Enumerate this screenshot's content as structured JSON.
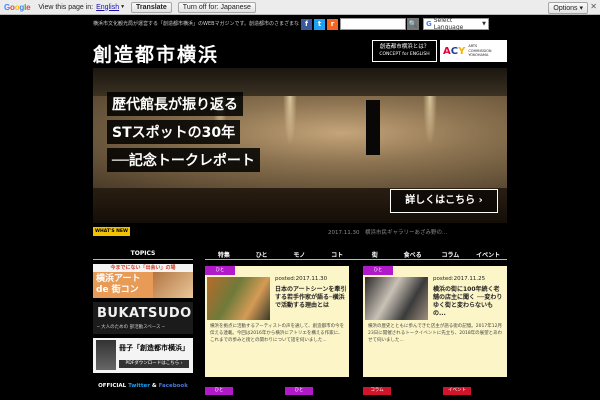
{
  "translate_bar": {
    "logo": [
      "G",
      "o",
      "o",
      "g",
      "l",
      "e"
    ],
    "view_text": "View this page in:",
    "language": "English",
    "translate_btn": "Translate",
    "turn_off_btn": "Turn off for: Japanese",
    "options": "Options ▾",
    "close": "✕"
  },
  "header": {
    "tagline": "横浜市文化観光局が運営する「創造都市横浜」のWEBマガジンです。創造都市のさまざまな",
    "social": {
      "facebook": "f",
      "twitter": "t",
      "rss": "r"
    },
    "search_btn": "🔍",
    "select_language": "Select Language",
    "logo": "創造都市横浜",
    "concept_btn": "創造都市横浜とは？",
    "concept_sub": "CONCEPT for ENGLISH",
    "acy_mark": [
      "A",
      "C",
      "Y"
    ],
    "acy_text": [
      "ARTS",
      "COMMISSION",
      "YOKOHAMA"
    ]
  },
  "hero": {
    "lines": [
      "歴代館長が振り返る",
      "STスポットの30年",
      "──記念トークレポート"
    ],
    "more": "詳しくはこちら ›"
  },
  "whats_new": {
    "badge": "WHAT'S NEW",
    "line": "2017.11.30　横浜市民ギャラリーあざみ野の..."
  },
  "sidebar": {
    "topics": "TOPICS",
    "banner1_head": "今までにない「出会い」の場",
    "banner1_main": [
      "横浜アート",
      "de 街コン"
    ],
    "banner2_main": "BUKATSUDO",
    "banner2_sub": "─ 大人のための 部活動スペース ─",
    "banner3_main": "冊子「創造都市横浜」",
    "banner3_pdf": "PDFダウンロードはこちら ›",
    "official": [
      "OFFICIAL ",
      "Twitter",
      " & ",
      "Facebook"
    ]
  },
  "nav": [
    "特集",
    "ひと",
    "モノ",
    "コト",
    "街",
    "食べる",
    "コラム",
    "イベント"
  ],
  "cards": [
    {
      "tag": "ひと",
      "date": "posted:2017.11.30",
      "title": "日本のアートシーンを牽引する若手作家が語る─横浜で活動する理由とは",
      "excerpt": "横浜を拠点に活動するアーティストの声を通して、創造都市の今を伝える連載。今回は2016年から横浜にアトリエを構える作家に、これまでの歩みと街との関わりについて話を伺いました..."
    },
    {
      "tag": "ひと",
      "date": "posted:2017.11.25",
      "title": "横浜の街に100年続く老舗の店主に聞く ──変わりゆく街と変わらないもの...",
      "excerpt": "横浜の歴史とともに歩んできた店主が語る街の記憶。2017年12月23日に開催されるトークイベントに先立ち、2018年の展望とあわせて伺いました..."
    }
  ],
  "bottom_tags": [
    {
      "label": "ひと",
      "color": "#b11ac9"
    },
    {
      "label": "ひと",
      "color": "#b11ac9"
    },
    {
      "label": "コラム",
      "color": "#d0152b"
    },
    {
      "label": "イベント",
      "color": "#d0152b"
    }
  ]
}
